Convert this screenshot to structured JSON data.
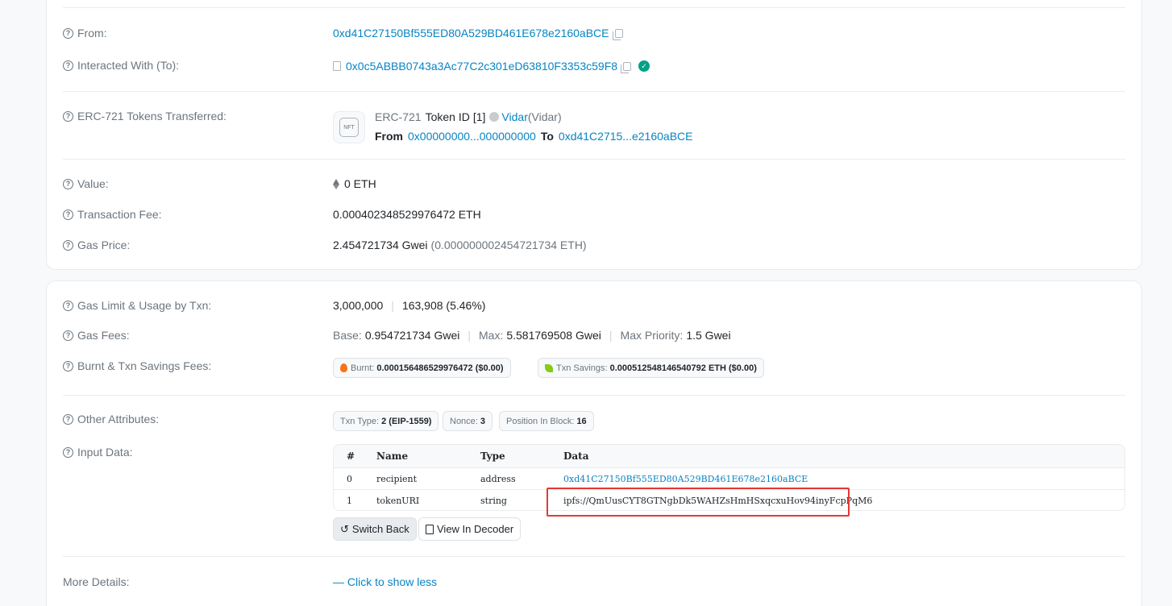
{
  "overview": {
    "from": {
      "label": "From:",
      "address": "0xd41C27150Bf555ED80A529BD461E678e2160aBCE"
    },
    "interacted_with": {
      "label": "Interacted With (To):",
      "address": "0x0c5ABBB0743a3Ac77C2c301eD63810F3353c59F8"
    },
    "erc721": {
      "label": "ERC-721 Tokens Transferred:",
      "nft_icon_text": "NFT",
      "standard": "ERC-721",
      "token_id_label": "Token ID",
      "token_id_value": "[1]",
      "collection_link": "Vidar",
      "collection_name": "(Vidar)",
      "from_label": "From",
      "from_address": "0x00000000...000000000",
      "to_label": "To",
      "to_address": "0xd41C2715...e2160aBCE"
    },
    "value": {
      "label": "Value:",
      "amount": "0 ETH"
    },
    "transaction_fee": {
      "label": "Transaction Fee:",
      "amount": "0.000402348529976472 ETH"
    },
    "gas_price": {
      "label": "Gas Price:",
      "gwei": "2.454721734 Gwei",
      "eth": "(0.000000002454721734 ETH)"
    }
  },
  "more": {
    "gas_limit": {
      "label": "Gas Limit & Usage by Txn:",
      "limit": "3,000,000",
      "usage": "163,908 (5.46%)"
    },
    "gas_fees": {
      "label": "Gas Fees:",
      "base_label": "Base:",
      "base": "0.954721734 Gwei",
      "max_label": "Max:",
      "max": "5.581769508 Gwei",
      "priority_label": "Max Priority:",
      "priority": "1.5 Gwei"
    },
    "burnt": {
      "label": "Burnt & Txn Savings Fees:",
      "burnt_label": "Burnt:",
      "burnt_value": "0.000156486529976472 ($0.00)",
      "savings_label": "Txn Savings:",
      "savings_value": "0.000512548146540792 ETH ($0.00)"
    },
    "other": {
      "label": "Other Attributes:",
      "txn_type_label": "Txn Type:",
      "txn_type": "2 (EIP-1559)",
      "nonce_label": "Nonce:",
      "nonce": "3",
      "position_label": "Position In Block:",
      "position": "16"
    },
    "input": {
      "label": "Input Data:",
      "headers": [
        "#",
        "Name",
        "Type",
        "Data"
      ],
      "rows": [
        [
          "0",
          "recipient",
          "address",
          "0xd41C27150Bf555ED80A529BD461E678e2160aBCE"
        ],
        [
          "1",
          "tokenURI",
          "string",
          "ipfs://QmUusCYT8GTNgbDk5WAHZsHmHSxqcxuHov94inyFcpPqM6"
        ]
      ],
      "switch_back": "Switch Back",
      "view_decoder": "View In Decoder"
    },
    "more_details": {
      "label": "More Details:",
      "toggle": "— Click to show less"
    }
  }
}
